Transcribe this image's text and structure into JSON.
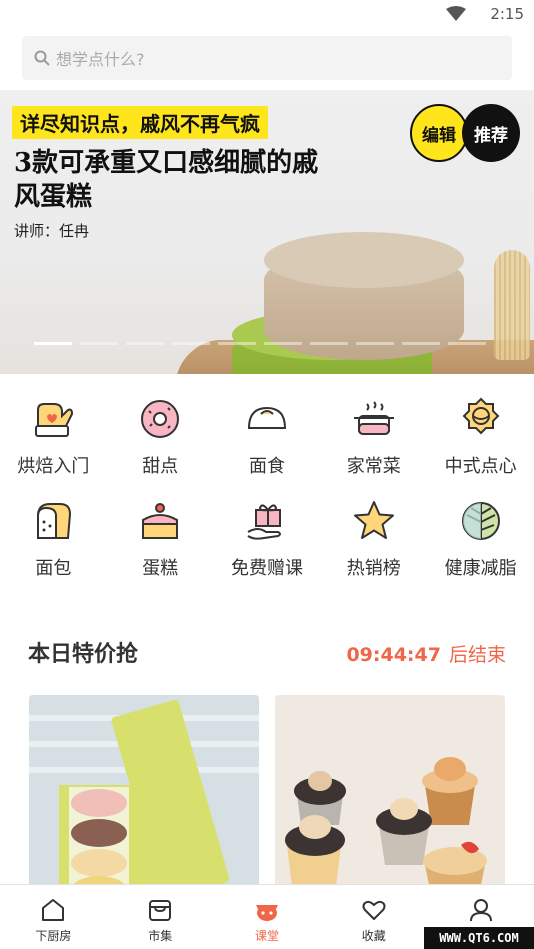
{
  "status": {
    "time": "2:15"
  },
  "search": {
    "placeholder": "想学点什么?"
  },
  "banner": {
    "tag": "详尽知识点，戚风不再气疯",
    "title": "3款可承重又口感细腻的戚风蛋糕",
    "lecturer": "讲师：任冉",
    "badge_edit": "编辑",
    "badge_recommend": "推荐"
  },
  "categories": [
    {
      "label": "烘焙入门",
      "icon": "oven-mitt-icon"
    },
    {
      "label": "甜点",
      "icon": "donut-icon"
    },
    {
      "label": "面食",
      "icon": "steamed-bun-icon"
    },
    {
      "label": "家常菜",
      "icon": "cooking-pot-icon"
    },
    {
      "label": "中式点心",
      "icon": "mooncake-icon"
    },
    {
      "label": "面包",
      "icon": "bread-icon"
    },
    {
      "label": "蛋糕",
      "icon": "cake-icon"
    },
    {
      "label": "免费赠课",
      "icon": "gift-icon"
    },
    {
      "label": "热销榜",
      "icon": "star-icon"
    },
    {
      "label": "健康减脂",
      "icon": "leaf-icon"
    }
  ],
  "deals": {
    "title": "本日特价抢",
    "countdown": "09:44:47",
    "countdown_suffix": "后结束"
  },
  "tabs": [
    {
      "label": "下厨房",
      "icon": "home-icon"
    },
    {
      "label": "市集",
      "icon": "market-icon"
    },
    {
      "label": "课堂",
      "icon": "classroom-icon"
    },
    {
      "label": "收藏",
      "icon": "heart-icon"
    },
    {
      "label": "",
      "icon": "profile-icon"
    }
  ],
  "watermark": "WWW.QT6.COM",
  "colors": {
    "accent": "#f06649",
    "tag_yellow": "#ffe51c",
    "icon_fill": "#ffd67a"
  }
}
